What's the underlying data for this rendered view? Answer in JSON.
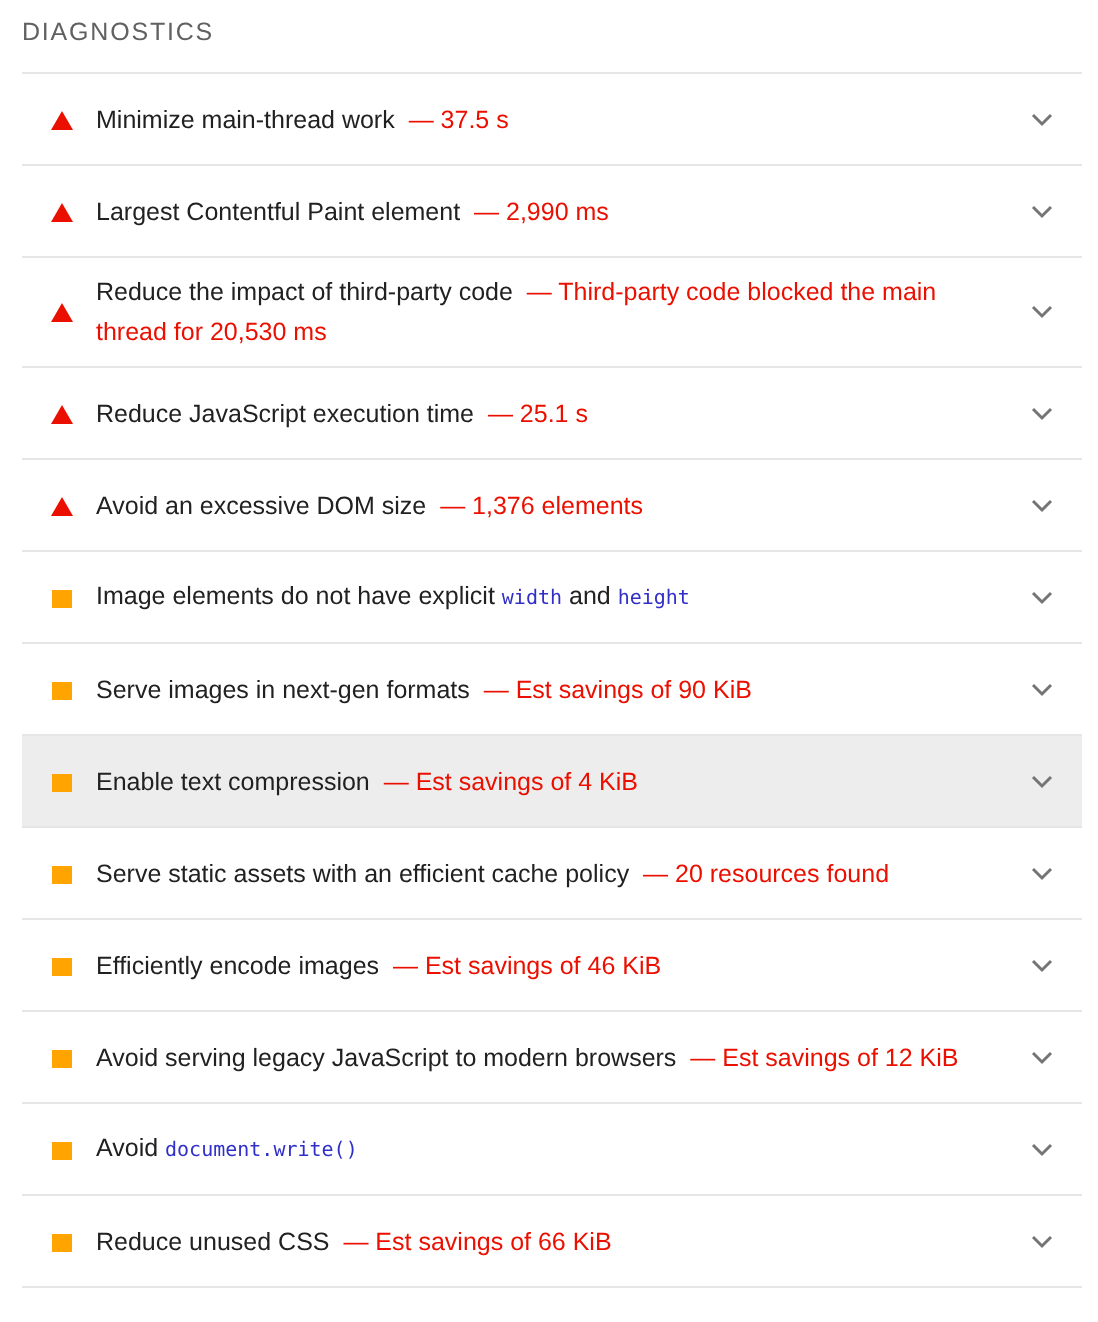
{
  "section_title": "DIAGNOSTICS",
  "audits": [
    {
      "kind": "fail",
      "title": [
        {
          "kind": "text",
          "text": "Minimize main-thread work"
        }
      ],
      "display_value": "— 37.5 s",
      "hovered": false
    },
    {
      "kind": "fail",
      "title": [
        {
          "kind": "text",
          "text": "Largest Contentful Paint element"
        }
      ],
      "display_value": "— 2,990 ms",
      "hovered": false
    },
    {
      "kind": "fail",
      "title": [
        {
          "kind": "text",
          "text": "Reduce the impact of third-party code"
        }
      ],
      "display_value": "— Third-party code blocked the main thread for 20,530 ms",
      "hovered": false
    },
    {
      "kind": "fail",
      "title": [
        {
          "kind": "text",
          "text": "Reduce JavaScript execution time"
        }
      ],
      "display_value": "— 25.1 s",
      "hovered": false
    },
    {
      "kind": "fail",
      "title": [
        {
          "kind": "text",
          "text": "Avoid an excessive DOM size"
        }
      ],
      "display_value": "— 1,376 elements",
      "hovered": false
    },
    {
      "kind": "average",
      "title": [
        {
          "kind": "text",
          "text": "Image elements do not have explicit "
        },
        {
          "kind": "code",
          "text": "width"
        },
        {
          "kind": "text",
          "text": " and "
        },
        {
          "kind": "code",
          "text": "height"
        }
      ],
      "hovered": false
    },
    {
      "kind": "average",
      "title": [
        {
          "kind": "text",
          "text": "Serve images in next-gen formats"
        }
      ],
      "display_value": "— Est savings of 90 KiB",
      "hovered": false
    },
    {
      "kind": "average",
      "title": [
        {
          "kind": "text",
          "text": "Enable text compression"
        }
      ],
      "display_value": "— Est savings of 4 KiB",
      "hovered": true
    },
    {
      "kind": "average",
      "title": [
        {
          "kind": "text",
          "text": "Serve static assets with an efficient cache policy"
        }
      ],
      "display_value": "— 20 resources found",
      "hovered": false
    },
    {
      "kind": "average",
      "title": [
        {
          "kind": "text",
          "text": "Efficiently encode images"
        }
      ],
      "display_value": "— Est savings of 46 KiB",
      "hovered": false
    },
    {
      "kind": "average",
      "title": [
        {
          "kind": "text",
          "text": "Avoid serving legacy JavaScript to modern browsers"
        }
      ],
      "display_value": "— Est savings of 12 KiB",
      "hovered": false
    },
    {
      "kind": "average",
      "title": [
        {
          "kind": "text",
          "text": "Avoid "
        },
        {
          "kind": "code",
          "text": "document.write()"
        }
      ],
      "hovered": false
    },
    {
      "kind": "average",
      "title": [
        {
          "kind": "text",
          "text": "Reduce unused CSS"
        }
      ],
      "display_value": "— Est savings of 66 KiB",
      "hovered": false
    }
  ]
}
